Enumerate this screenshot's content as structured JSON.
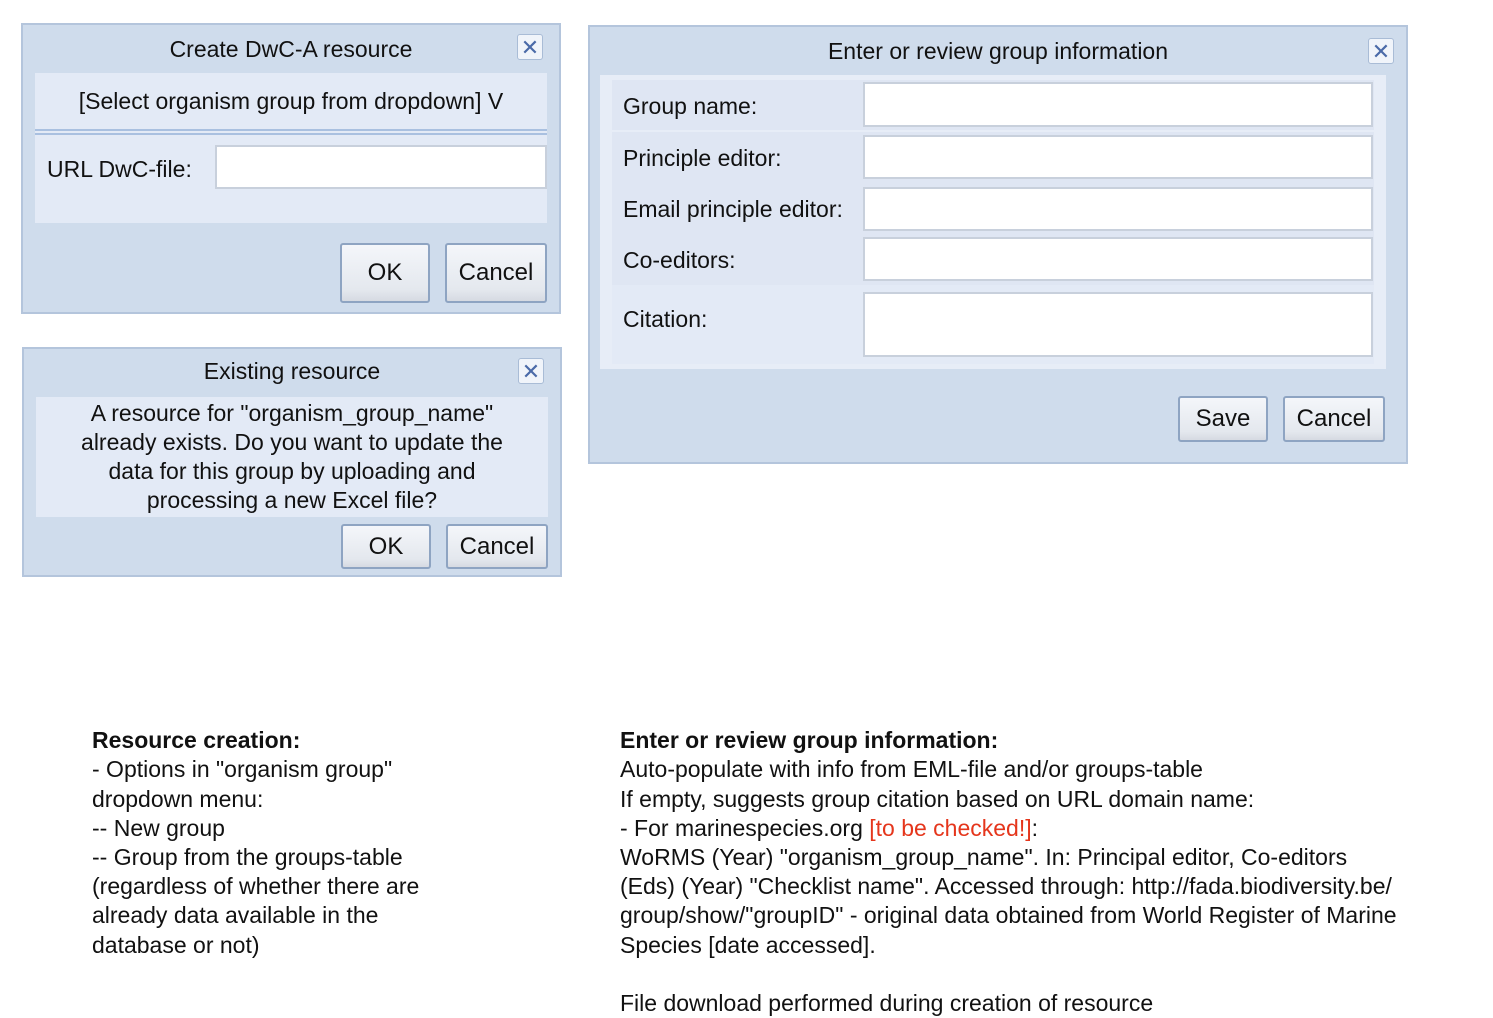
{
  "create_dialog": {
    "title": "Create DwC-A resource",
    "dropdown": "[Select organism group from dropdown] V",
    "url_label": "URL DwC-file:",
    "url_value": "",
    "ok": "OK",
    "cancel": "Cancel"
  },
  "existing_dialog": {
    "title": "Existing resource",
    "message_lines": [
      "A resource for \"organism_group_name\"",
      "already exists. Do you want to update the",
      "data for this group by uploading and",
      "processing a new Excel file?"
    ],
    "ok": "OK",
    "cancel": "Cancel"
  },
  "group_dialog": {
    "title": "Enter or review group information",
    "fields": [
      {
        "label": "Group name:",
        "value": ""
      },
      {
        "label": "Principle editor:",
        "value": ""
      },
      {
        "label": "Email principle editor:",
        "value": ""
      },
      {
        "label": "Co-editors:",
        "value": ""
      },
      {
        "label": "Citation:",
        "value": ""
      }
    ],
    "save": "Save",
    "cancel": "Cancel"
  },
  "notes_left": {
    "heading": "Resource creation:",
    "lines": [
      "- Options in \"organism group\"",
      "dropdown menu:",
      "-- New group",
      "-- Group from the groups-table",
      "(regardless of whether there are",
      "already data available in the",
      "database or not)"
    ]
  },
  "notes_right": {
    "heading": "Enter or review group information:",
    "lines": [
      "Auto-populate with info from EML-file and/or groups-table",
      "If empty, suggests group citation based on URL domain name:"
    ],
    "marine_prefix": "- For marinespecies.org ",
    "marine_flag": "[to be checked!]",
    "marine_suffix": ":",
    "citation_lines": [
      "WoRMS (Year) \"organism_group_name\". In: Principal editor, Co-editors",
      "(Eds) (Year) \"Checklist name\". Accessed through: http://fada.biodiversity.be/",
      "group/show/\"groupID\" - original data obtained from World Register of Marine",
      "Species [date accessed]."
    ],
    "footer": "File download performed during creation of resource"
  },
  "colors": {
    "dialog_bg": "#cfdcec",
    "panel_bg": "#e3eaf6",
    "flag": "#e5361c"
  },
  "icons": {
    "close": "close-x-icon"
  }
}
